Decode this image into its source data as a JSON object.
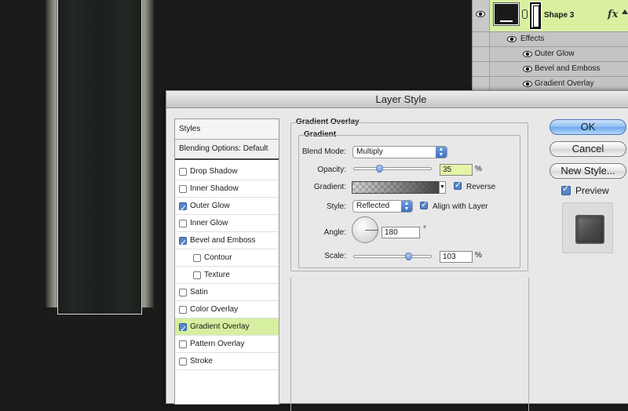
{
  "layers_panel": {
    "layer_name": "Shape 3",
    "fx_label": "fx",
    "effects_label": "Effects",
    "effects": [
      "Outer Glow",
      "Bevel and Emboss",
      "Gradient Overlay"
    ]
  },
  "dialog": {
    "title": "Layer Style",
    "styles_header": "Styles",
    "blending_options": "Blending Options: Default",
    "style_items": [
      {
        "label": "Drop Shadow",
        "checked": false,
        "selected": false
      },
      {
        "label": "Inner Shadow",
        "checked": false,
        "selected": false
      },
      {
        "label": "Outer Glow",
        "checked": true,
        "selected": false
      },
      {
        "label": "Inner Glow",
        "checked": false,
        "selected": false
      },
      {
        "label": "Bevel and Emboss",
        "checked": true,
        "selected": false
      },
      {
        "label": "Contour",
        "checked": false,
        "selected": false
      },
      {
        "label": "Texture",
        "checked": false,
        "selected": false
      },
      {
        "label": "Satin",
        "checked": false,
        "selected": false
      },
      {
        "label": "Color Overlay",
        "checked": false,
        "selected": false
      },
      {
        "label": "Gradient Overlay",
        "checked": true,
        "selected": true
      },
      {
        "label": "Pattern Overlay",
        "checked": false,
        "selected": false
      },
      {
        "label": "Stroke",
        "checked": false,
        "selected": false
      }
    ],
    "settings": {
      "section_title": "Gradient Overlay",
      "group_title": "Gradient",
      "blend_mode_label": "Blend Mode:",
      "blend_mode_value": "Multiply",
      "opacity_label": "Opacity:",
      "opacity_value": "35",
      "opacity_percent": 35,
      "percent_unit": "%",
      "gradient_label": "Gradient:",
      "reverse_label": "Reverse",
      "reverse_checked": true,
      "style_label": "Style:",
      "style_value": "Reflected",
      "align_label": "Align with Layer",
      "align_checked": true,
      "angle_label": "Angle:",
      "angle_value": "180",
      "degree_unit": "°",
      "scale_label": "Scale:",
      "scale_value": "103",
      "scale_percent": 103
    },
    "buttons": {
      "ok": "OK",
      "cancel": "Cancel",
      "new_style": "New Style...",
      "preview_label": "Preview",
      "preview_checked": true
    }
  },
  "colors": {
    "selection_green": "#d6efa0",
    "accent_blue": "#6aa7ee",
    "canvas_bg": "#1b1b1b"
  }
}
